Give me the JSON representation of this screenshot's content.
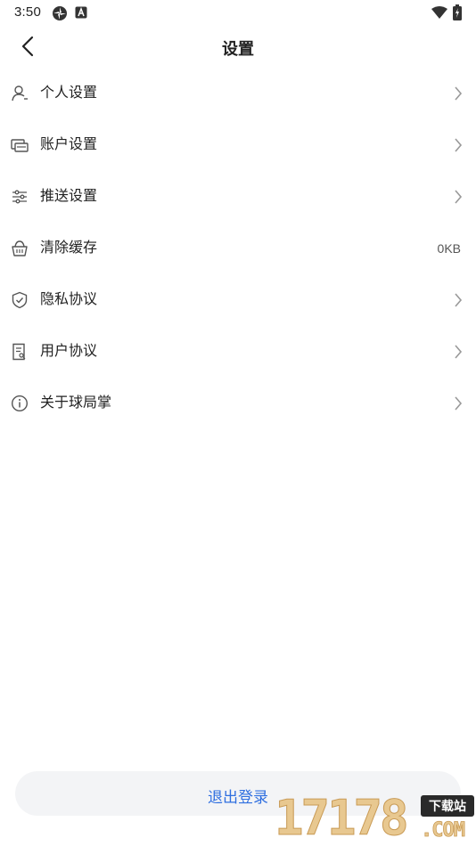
{
  "status_bar": {
    "time": "3:50",
    "icons": [
      "pinwheel-icon",
      "a-badge-icon",
      "wifi-icon",
      "battery-charging-icon"
    ]
  },
  "header": {
    "title": "设置",
    "back_icon": "chevron-left-icon"
  },
  "menu": {
    "items": [
      {
        "label": "个人设置",
        "icon": "person-icon",
        "trailing": "chevron-right-icon"
      },
      {
        "label": "账户设置",
        "icon": "card-icon",
        "trailing": "chevron-right-icon"
      },
      {
        "label": "推送设置",
        "icon": "sliders-icon",
        "trailing": "chevron-right-icon"
      },
      {
        "label": "清除缓存",
        "icon": "basket-icon",
        "value": "0KB"
      },
      {
        "label": "隐私协议",
        "icon": "shield-check-icon",
        "trailing": "chevron-right-icon"
      },
      {
        "label": "用户协议",
        "icon": "document-icon",
        "trailing": "chevron-right-icon"
      },
      {
        "label": "关于球局掌",
        "icon": "info-icon",
        "trailing": "chevron-right-icon"
      }
    ]
  },
  "logout": {
    "label": "退出登录"
  },
  "watermark": {
    "digits": "17178",
    "badge": "下载站",
    "domain": ".COM"
  },
  "colors": {
    "accent": "#2f6fe0",
    "text": "#222222",
    "secondary": "#555555",
    "icon": "#555555",
    "button_bg": "#f3f4f6"
  }
}
